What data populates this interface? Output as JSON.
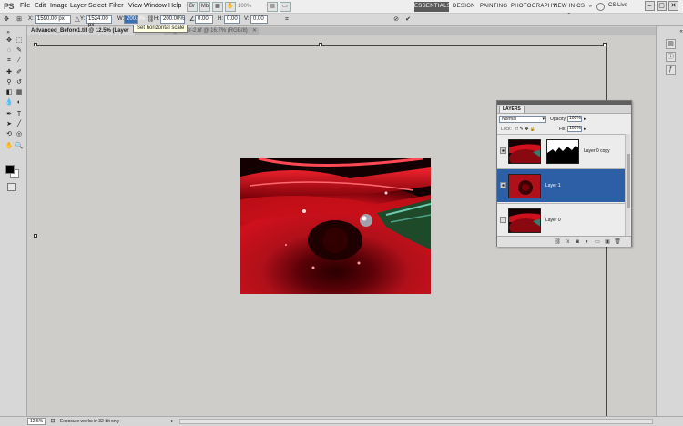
{
  "app": {
    "logo": "PS"
  },
  "menu": {
    "items": [
      "File",
      "Edit",
      "Image",
      "Layer",
      "Select",
      "Filter",
      "View",
      "Window",
      "Help"
    ],
    "zoom": "100%"
  },
  "workspaces": [
    "ESSENTIALS",
    "DESIGN",
    "PAINTING",
    "PHOTOGRAPHY",
    "NEW IN CS 5"
  ],
  "cs_live": "CS Live",
  "options_bar": {
    "x_label": "X:",
    "x_value": "1590.00 px",
    "y_label": "Y:",
    "y_value": "1524.00 px",
    "w_label": "W:",
    "w_value": "200.0%",
    "h_label": "H:",
    "h_value": "200.00%",
    "angle_value": "0.00",
    "hskew_label": "H:",
    "hskew_value": "0.00",
    "vskew_label": "V:",
    "vskew_value": "0.00",
    "tooltip": "Set horizontal scale"
  },
  "tabs": [
    {
      "label": "Advanced_Before1.tif @ 12.5% (Layer 1, RGB",
      "active": true
    },
    {
      "label": "ed_flower-2.tif @ 16.7% (RGB/8)",
      "active": false
    }
  ],
  "layers_panel": {
    "tab_label": "LAYERS",
    "blend_mode": "Normal",
    "opacity_label": "Opacity:",
    "opacity_value": "100%",
    "lock_label": "Lock:",
    "fill_label": "Fill:",
    "fill_value": "100%",
    "layers": [
      {
        "name": "Layer 0 copy",
        "visible": true,
        "selected": false,
        "has_mask": true
      },
      {
        "name": "Layer 1",
        "visible": true,
        "selected": true,
        "has_mask": false
      },
      {
        "name": "Layer 0",
        "visible": false,
        "selected": false,
        "has_mask": false
      }
    ]
  },
  "status": {
    "zoom": "12.5%",
    "info": "Exposure works in 32-bit only"
  },
  "colors": {
    "selected_layer": "#2c5fa6",
    "accent_blue": "#3a6fb5",
    "flower_red": "#d0101c"
  }
}
